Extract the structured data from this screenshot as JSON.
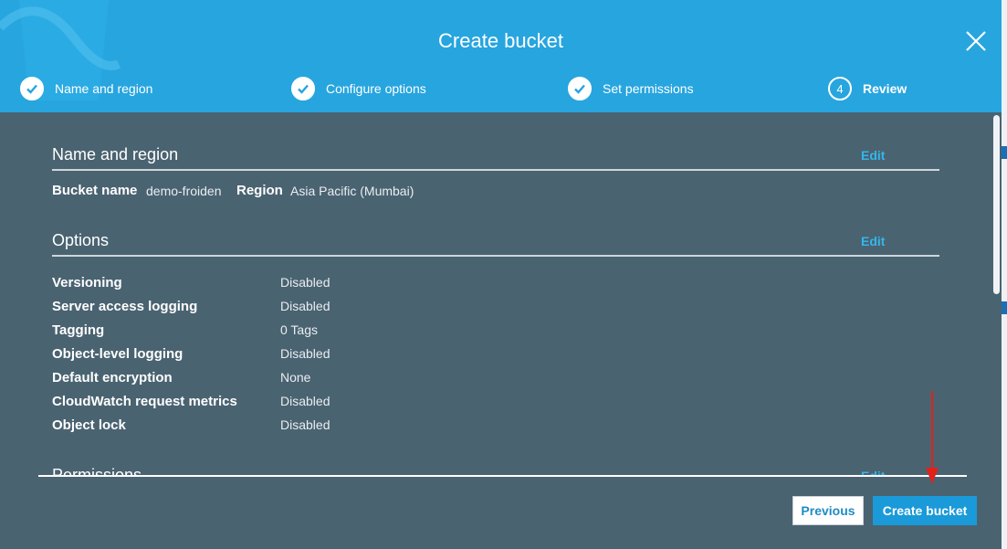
{
  "modal": {
    "title": "Create bucket",
    "steps": [
      {
        "label": "Name and region",
        "state": "complete"
      },
      {
        "label": "Configure options",
        "state": "complete"
      },
      {
        "label": "Set permissions",
        "state": "complete"
      },
      {
        "label": "Review",
        "number": "4",
        "state": "current"
      }
    ]
  },
  "sections": {
    "name_region": {
      "title": "Name and region",
      "edit": "Edit",
      "bucket_name_label": "Bucket name",
      "bucket_name_value": "demo-froiden",
      "region_label": "Region",
      "region_value": "Asia Pacific (Mumbai)"
    },
    "options": {
      "title": "Options",
      "edit": "Edit",
      "rows": [
        {
          "label": "Versioning",
          "value": "Disabled"
        },
        {
          "label": "Server access logging",
          "value": "Disabled"
        },
        {
          "label": "Tagging",
          "value": "0 Tags"
        },
        {
          "label": "Object-level logging",
          "value": "Disabled"
        },
        {
          "label": "Default encryption",
          "value": "None"
        },
        {
          "label": "CloudWatch request metrics",
          "value": "Disabled"
        },
        {
          "label": "Object lock",
          "value": "Disabled"
        }
      ]
    },
    "permissions": {
      "title": "Permissions",
      "edit": "Edit"
    }
  },
  "footer": {
    "previous_label": "Previous",
    "create_label": "Create bucket"
  },
  "colors": {
    "header": "#27a5df",
    "body": "#4a6371",
    "link": "#34b6ec",
    "primary_button": "#1a9ad8",
    "annotation_arrow": "#e0221b"
  },
  "icons": [
    "check-circle-icon",
    "close-icon",
    "annotation-arrow"
  ]
}
